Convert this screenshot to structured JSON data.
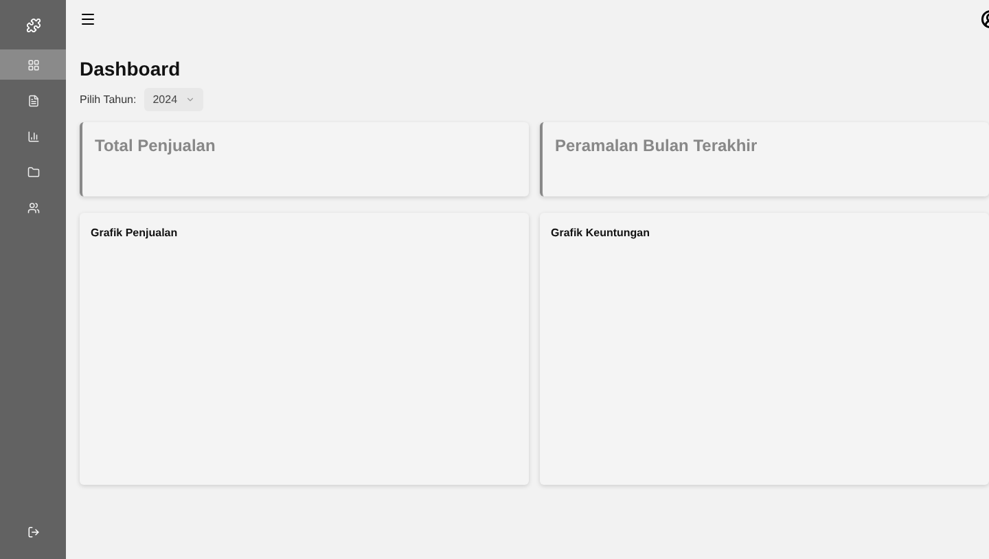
{
  "sidebar": {
    "items": [
      {
        "kind": "grid",
        "selected": true
      },
      {
        "kind": "file",
        "selected": false
      },
      {
        "kind": "chart",
        "selected": false
      },
      {
        "kind": "folder",
        "selected": false
      },
      {
        "kind": "users",
        "selected": false
      }
    ]
  },
  "page_title": "Dashboard",
  "year_filter": {
    "label": "Pilih Tahun:",
    "value": "2024"
  },
  "summary_cards": [
    {
      "title": "Total Penjualan"
    },
    {
      "title": "Peramalan Bulan Terakhir"
    }
  ],
  "chart_cards": [
    {
      "title": "Grafik Penjualan"
    },
    {
      "title": "Grafik Keuntungan"
    }
  ]
}
